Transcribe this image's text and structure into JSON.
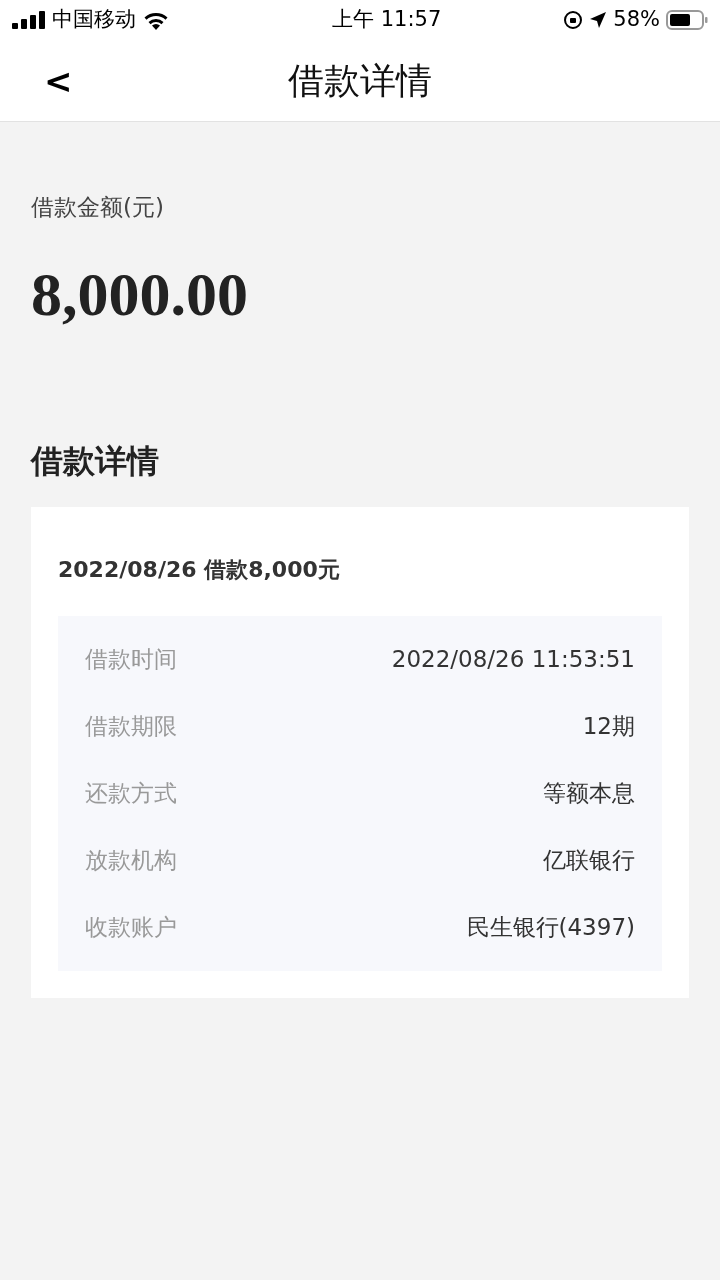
{
  "status_bar": {
    "carrier": "中国移动",
    "time": "上午 11:57",
    "battery": "58%"
  },
  "nav": {
    "back": "<",
    "title": "借款详情"
  },
  "amount": {
    "label": "借款金额(元)",
    "value": "8,000.00"
  },
  "section_title": "借款详情",
  "card": {
    "title": "2022/08/26 借款8,000元",
    "rows": [
      {
        "label": "借款时间",
        "value": "2022/08/26 11:53:51"
      },
      {
        "label": "借款期限",
        "value": "12期"
      },
      {
        "label": "还款方式",
        "value": "等额本息"
      },
      {
        "label": "放款机构",
        "value": "亿联银行"
      },
      {
        "label": "收款账户",
        "value": "民生银行(4397)"
      }
    ]
  }
}
